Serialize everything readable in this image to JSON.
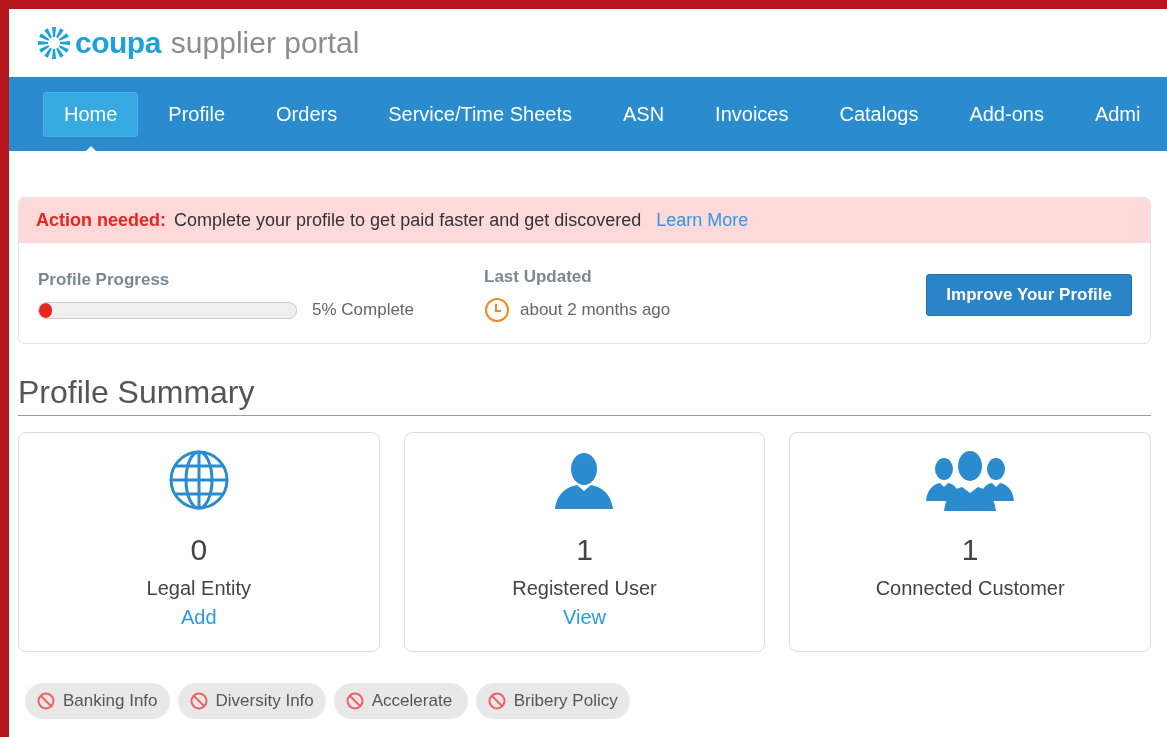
{
  "logo": {
    "brand": "coupa",
    "product": "supplier portal"
  },
  "nav": [
    {
      "label": "Home",
      "selected": true
    },
    {
      "label": "Profile",
      "selected": false
    },
    {
      "label": "Orders",
      "selected": false
    },
    {
      "label": "Service/Time Sheets",
      "selected": false
    },
    {
      "label": "ASN",
      "selected": false
    },
    {
      "label": "Invoices",
      "selected": false
    },
    {
      "label": "Catalogs",
      "selected": false
    },
    {
      "label": "Add-ons",
      "selected": false
    },
    {
      "label": "Admi",
      "selected": false
    }
  ],
  "alert": {
    "label": "Action needed:",
    "message": "Complete your profile to get paid faster and get discovered",
    "link": "Learn More"
  },
  "progress": {
    "title": "Profile Progress",
    "level": 0.05,
    "reading": "5% Complete"
  },
  "last_updated": {
    "title": "Last Updated",
    "value": "about 2 months ago"
  },
  "improve_button": "Improve Your Profile",
  "summary": {
    "title": "Profile Summary",
    "cards": [
      {
        "kind": "globe",
        "count": "0",
        "label": "Legal Entity",
        "link": "Add"
      },
      {
        "kind": "user",
        "count": "1",
        "label": "Registered User",
        "link": "View"
      },
      {
        "kind": "group",
        "count": "1",
        "label": "Connected Customer"
      }
    ]
  },
  "chips": [
    "Banking Info",
    "Diversity Info",
    "Accelerate",
    "Bribery Policy"
  ]
}
